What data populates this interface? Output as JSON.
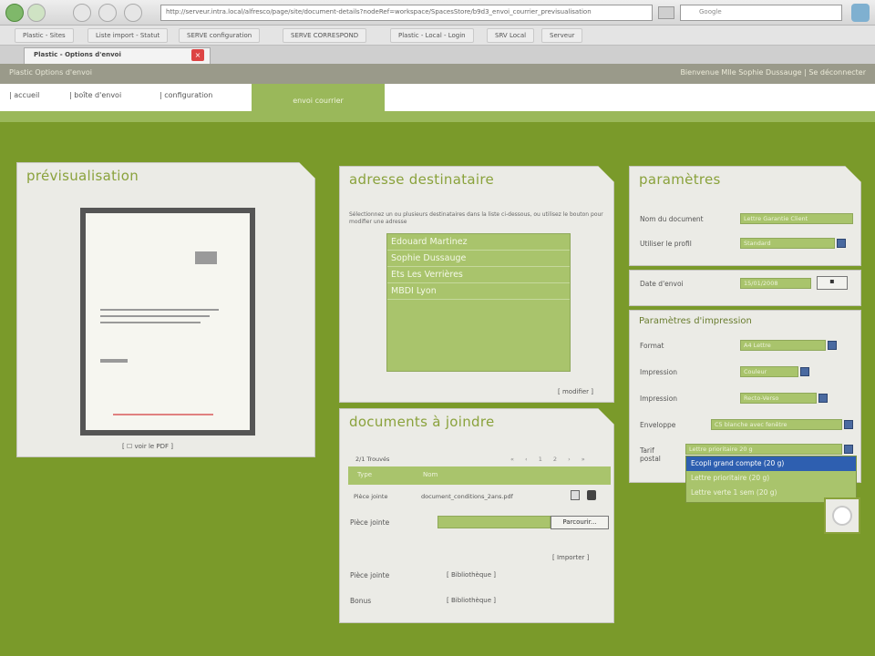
{
  "browser": {
    "url": "http://serveur.intra.local/alfresco/page/site/document-details?nodeRef=workspace/SpacesStore/b9d3_envoi_courrier_previsualisation",
    "search_placeholder": "Google",
    "bookmarks": [
      "Plastic - Sites",
      "Liste import - Statut",
      "SERVE configuration",
      "SERVE CORRESPOND",
      "Plastic - Local - Login",
      "SRV Local",
      "Serveur"
    ],
    "tab_title": "Plastic - Options d'envoi"
  },
  "app": {
    "left_header": "Plastic   Options d'envoi",
    "right_header": "Bienvenue Mlle Sophie Dussauge   |   Se déconnecter",
    "nav": [
      "accueil",
      "boîte d'envoi",
      "configuration"
    ],
    "active_tab": "envoi courrier"
  },
  "preview": {
    "title": "prévisualisation",
    "link": "voir le PDF"
  },
  "recipients": {
    "title": "adresse destinataire",
    "intro": "Sélectionnez un ou plusieurs destinataires dans la liste ci-dessous, ou utilisez le bouton pour modifier une adresse",
    "items": [
      "Edouard Martinez",
      "Sophie Dussauge",
      "Ets Les Verrières",
      "MBDI Lyon"
    ],
    "modify_link": "modifier"
  },
  "documents": {
    "title": "documents à joindre",
    "count_label": "2/1 Trouvés",
    "columns": [
      "Type",
      "Nom"
    ],
    "row": {
      "type": "Pièce jointe",
      "name": "document_conditions_2ans.pdf"
    },
    "attach_label": "Pièce jointe",
    "browse_label": "Parcourir...",
    "add_link": "Importer",
    "library_rows": [
      "Pièce jointe",
      "Bonus"
    ],
    "library_link": "Bibliothèque"
  },
  "params": {
    "title": "paramètres",
    "rows": [
      {
        "label": "Nom du document",
        "value": "Lettre Garantie Client"
      },
      {
        "label": "Utiliser le profil",
        "value": "Standard"
      }
    ],
    "date_label": "Date d'envoi",
    "date_value": "15/01/2008"
  },
  "print": {
    "title": "Paramètres d'impression",
    "rows": [
      {
        "label": "Format",
        "value": "A4 Lettre"
      },
      {
        "label": "Impression",
        "value": "Couleur"
      },
      {
        "label": "Impression",
        "value": "Recto-Verso"
      },
      {
        "label": "Enveloppe",
        "value": "C5 blanche avec fenêtre"
      },
      {
        "label": "Tarif postal",
        "value": "Lettre prioritaire 20 g"
      }
    ],
    "dropdown_options": [
      "Ecopli grand compte (20 g)",
      "Lettre prioritaire (20 g)",
      "Lettre verte 1 sem (20 g)"
    ]
  },
  "colors": {
    "accent": "#8aa23c",
    "field": "#a9c46c",
    "background": "#7a9a2a",
    "selected": "#2e5fb0"
  }
}
